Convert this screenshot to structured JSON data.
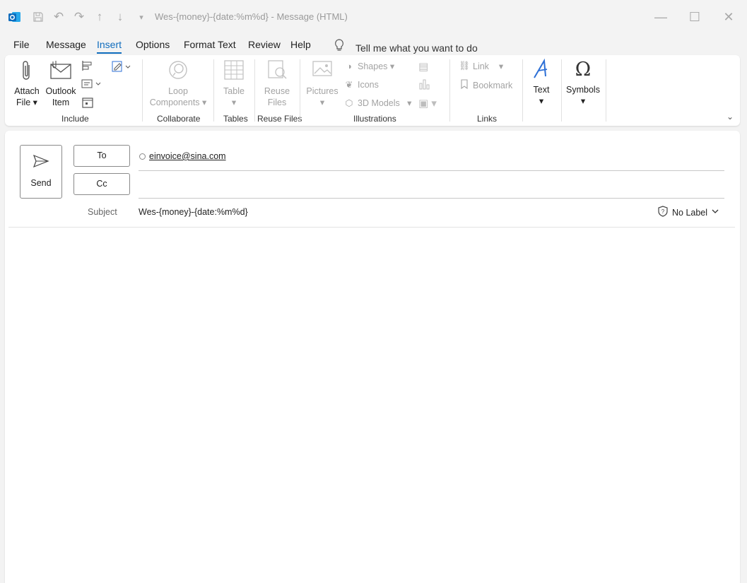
{
  "window": {
    "title": "Wes-{money}-{date:%m%d}  -  Message (HTML)"
  },
  "quick_access": [
    "outlook-app-icon",
    "save-icon",
    "undo-icon",
    "redo-icon",
    "up-arrow-icon",
    "down-arrow-icon",
    "customize-icon"
  ],
  "menu": {
    "items": [
      "File",
      "Message",
      "Insert",
      "Options",
      "Format Text",
      "Review",
      "Help"
    ],
    "active": "Insert",
    "tell_me": "Tell me what you want to do"
  },
  "ribbon": {
    "include": {
      "attach_file": "Attach",
      "attach_file_2": "File",
      "outlook_item": "Outlook",
      "outlook_item_2": "Item",
      "label": "Include"
    },
    "collaborate": {
      "loop": "Loop",
      "loop_2": "Components",
      "label": "Collaborate"
    },
    "tables": {
      "table": "Table",
      "label": "Tables"
    },
    "reuse": {
      "reuse": "Reuse",
      "reuse_2": "Files",
      "label": "Reuse Files"
    },
    "illustrations": {
      "pictures": "Pictures",
      "shapes": "Shapes",
      "icons": "Icons",
      "models": "3D Models",
      "label": "Illustrations"
    },
    "links": {
      "link": "Link",
      "bookmark": "Bookmark",
      "label": "Links"
    },
    "text": {
      "text": "Text"
    },
    "symbols": {
      "symbols": "Symbols"
    }
  },
  "compose": {
    "send_label": "Send",
    "to_label": "To",
    "cc_label": "Cc",
    "to_recipient": "einvoice@sina.com",
    "cc_value": "",
    "subject_label": "Subject",
    "subject_value": "Wes-{money}-{date:%m%d}",
    "sensitivity_label": "No Label"
  }
}
